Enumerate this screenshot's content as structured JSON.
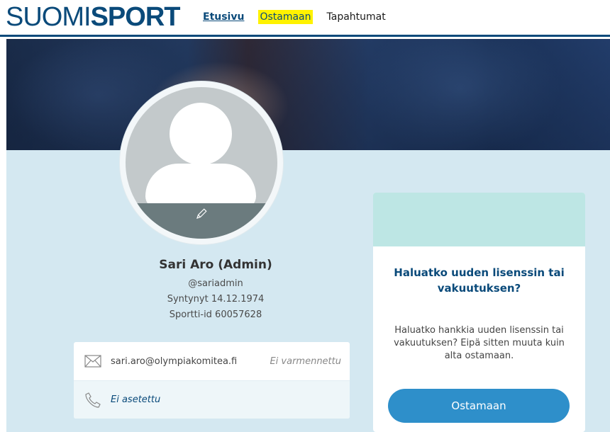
{
  "brand": {
    "logo_thin": "SUOMI",
    "logo_bold": "SP",
    "logo_o": "O",
    "logo_end": "RT"
  },
  "nav": {
    "home": "Etusivu",
    "buy": "Ostamaan",
    "events": "Tapahtumat"
  },
  "profile": {
    "name": "Sari Aro (Admin)",
    "username": "@sariadmin",
    "birth": "Syntynyt 14.12.1974",
    "sportti_id": "Sportti-id 60057628"
  },
  "contact": {
    "email": "sari.aro@olympiakomitea.fi",
    "email_status": "Ei varmennettu",
    "phone": "Ei asetettu"
  },
  "offer": {
    "title": "Haluatko uuden lisenssin tai vakuutuksen?",
    "text": "Haluatko hankkia uuden lisenssin tai vakuutuksen? Eipä sitten muuta kuin alta ostamaan.",
    "button": "Ostamaan"
  },
  "colors": {
    "brand_blue": "#0a4a7a",
    "highlight": "#fff200",
    "background": "#d4e8f1",
    "button": "#2e8fca",
    "offer_header": "#bde6e4"
  },
  "icons": [
    "edit-pencil-icon",
    "mail-icon",
    "phone-icon"
  ]
}
